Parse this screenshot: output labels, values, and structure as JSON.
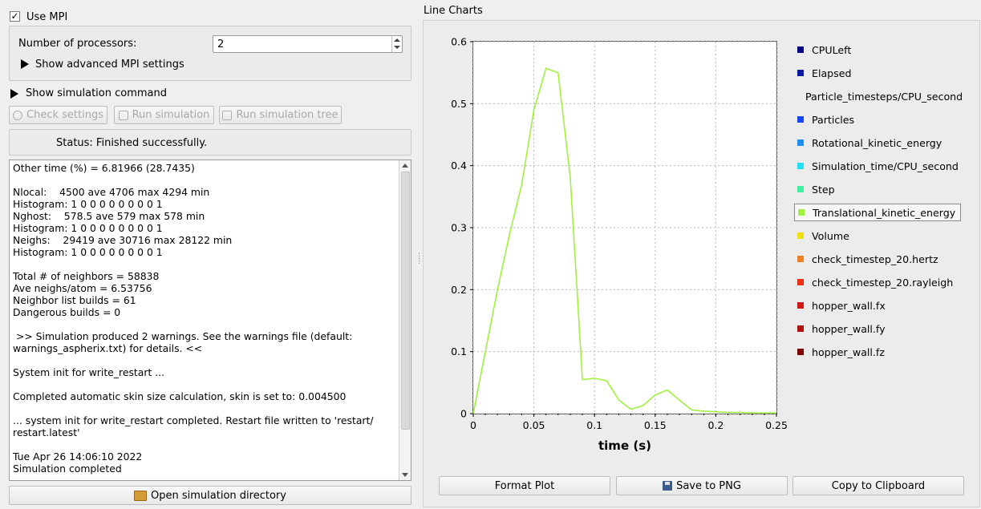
{
  "mpi": {
    "use_label": "Use MPI",
    "use_checked": "✓",
    "processors_label": "Number of processors:",
    "processors_value": "2",
    "advanced_label": "Show advanced MPI settings"
  },
  "simulation": {
    "show_command_label": "Show simulation command",
    "check_settings": "Check settings",
    "run_simulation": "Run simulation",
    "run_tree": "Run simulation tree",
    "status": "Status: Finished successfully.",
    "open_dir": "Open simulation directory",
    "log_lines": [
      "Other time (%) = 6.81966 (28.7435)",
      "",
      "Nlocal:    4500 ave 4706 max 4294 min",
      "Histogram: 1 0 0 0 0 0 0 0 0 1",
      "Nghost:    578.5 ave 579 max 578 min",
      "Histogram: 1 0 0 0 0 0 0 0 0 1",
      "Neighs:    29419 ave 30716 max 28122 min",
      "Histogram: 1 0 0 0 0 0 0 0 0 1",
      "",
      "Total # of neighbors = 58838",
      "Ave neighs/atom = 6.53756",
      "Neighbor list builds = 61",
      "Dangerous builds = 0",
      "",
      " >> Simulation produced 2 warnings. See the warnings file (default:",
      "warnings_aspherix.txt) for details. <<",
      "",
      "System init for write_restart ...",
      "",
      "Completed automatic skin size calculation, skin is set to: 0.004500",
      "",
      "... system init for write_restart completed. Restart file written to 'restart/",
      "restart.latest'",
      "",
      "Tue Apr 26 14:06:10 2022",
      "Simulation completed"
    ]
  },
  "chart_panel": {
    "title": "Line Charts",
    "format_plot": "Format Plot",
    "save_png": "Save to PNG",
    "copy_clipboard": "Copy to Clipboard"
  },
  "chart_data": {
    "type": "line",
    "xlabel": "time (s)",
    "ylabel": "",
    "xlim": [
      0,
      0.25
    ],
    "ylim": [
      0,
      0.6
    ],
    "xticks": [
      0,
      0.05,
      0.1,
      0.15,
      0.2,
      0.25
    ],
    "xtick_labels": [
      "0",
      "0.05",
      "0.1",
      "0.15",
      "0.2",
      "0.25"
    ],
    "yticks": [
      0,
      0.1,
      0.2,
      0.3,
      0.4,
      0.5,
      0.6
    ],
    "ytick_labels": [
      "0",
      "0.1",
      "0.2",
      "0.3",
      "0.4",
      "0.5",
      "0.6"
    ],
    "grid": true,
    "legend_position": "right",
    "legend": [
      {
        "name": "CPULeft",
        "color": "#000080"
      },
      {
        "name": "Elapsed",
        "color": "#0a1aa0"
      },
      {
        "name": "Particle_timesteps/CPU_second",
        "color": "#0a22d8"
      },
      {
        "name": "Particles",
        "color": "#1448f0"
      },
      {
        "name": "Rotational_kinetic_energy",
        "color": "#2090f0"
      },
      {
        "name": "Simulation_time/CPU_second",
        "color": "#20e0f0"
      },
      {
        "name": "Step",
        "color": "#40f0a0"
      },
      {
        "name": "Translational_kinetic_energy",
        "color": "#a0f040"
      },
      {
        "name": "Volume",
        "color": "#f0e010"
      },
      {
        "name": "check_timestep_20.hertz",
        "color": "#f08020"
      },
      {
        "name": "check_timestep_20.rayleigh",
        "color": "#f03010"
      },
      {
        "name": "hopper_wall.fx",
        "color": "#d01818"
      },
      {
        "name": "hopper_wall.fy",
        "color": "#b01010"
      },
      {
        "name": "hopper_wall.fz",
        "color": "#800000"
      }
    ],
    "selected_series": "Translational_kinetic_energy",
    "series": [
      {
        "name": "Translational_kinetic_energy",
        "color": "#a0f040",
        "x": [
          0,
          0.01,
          0.02,
          0.03,
          0.04,
          0.05,
          0.06,
          0.07,
          0.08,
          0.09,
          0.1,
          0.11,
          0.12,
          0.13,
          0.14,
          0.15,
          0.16,
          0.17,
          0.18,
          0.19,
          0.2,
          0.21,
          0.22,
          0.23,
          0.24,
          0.25
        ],
        "y": [
          0,
          0.1,
          0.2,
          0.29,
          0.37,
          0.49,
          0.557,
          0.55,
          0.38,
          0.055,
          0.057,
          0.053,
          0.022,
          0.007,
          0.013,
          0.03,
          0.038,
          0.022,
          0.006,
          0.004,
          0.003,
          0.002,
          0.002,
          0.001,
          0.001,
          0.001
        ]
      }
    ]
  }
}
